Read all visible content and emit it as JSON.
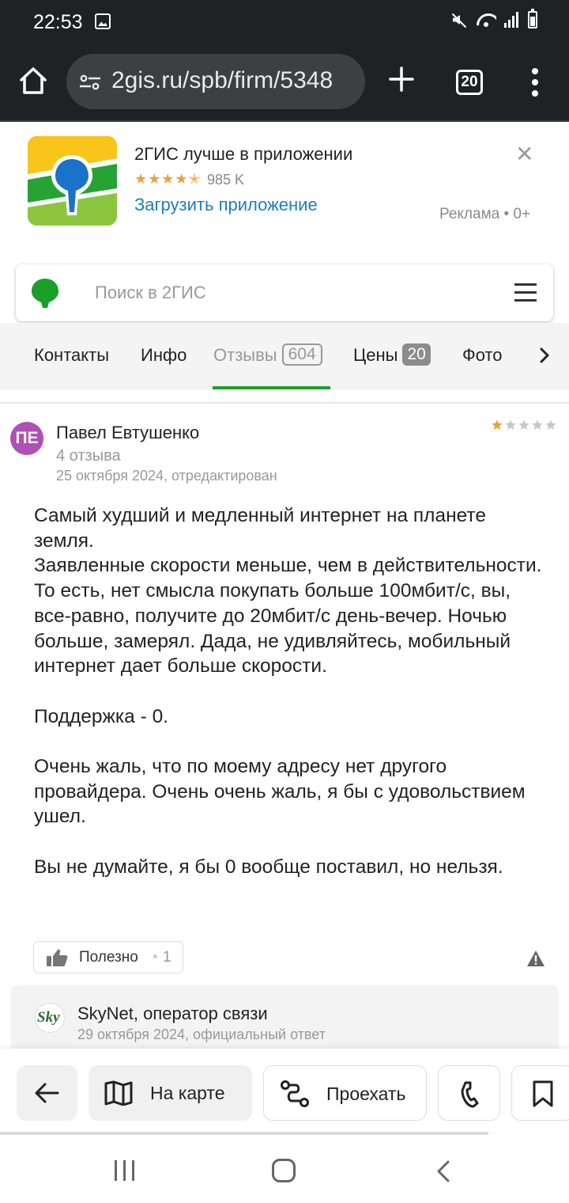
{
  "status_bar": {
    "time": "22:53"
  },
  "browser": {
    "url": "2gis.ru/spb/firm/5348",
    "tabs_count": "20"
  },
  "app_banner": {
    "title": "2ГИС лучше в приложении",
    "rating_stars": "★★★★✭",
    "reviews_count": "985 K",
    "download_link": "Загрузить приложение",
    "ad_label": "Реклама • 0+",
    "close_glyph": "✕"
  },
  "search": {
    "placeholder": "Поиск в 2ГИС"
  },
  "tabs": [
    {
      "label": "Контакты"
    },
    {
      "label": "Инфо"
    },
    {
      "label": "Отзывы",
      "badge": "604"
    },
    {
      "label": "Цены",
      "badge": "20"
    },
    {
      "label": "Фото"
    }
  ],
  "review": {
    "avatar_initials": "ПЕ",
    "author": "Павел Евтушенко",
    "author_reviews": "4 отзыва",
    "date": "25 октября 2024, отредактирован",
    "rating": 1,
    "rating_max": 5,
    "text": "Самый худший и медленный интернет на планете земля.\nЗаявленные скорости меньше, чем в действительности. То есть, нет смысла покупать больше 100мбит/с, вы, все-равно, получите до 20мбит/с день-вечер. Ночью больше, замерял. Дада, не удивляйтесь, мобильный интернет дает больше скорости.\n\nПоддержка - 0.\n\nОчень жаль, что по моему адресу нет другого провайдера. Очень очень жаль, я бы с удовольствием ушел.\n\nВы не думайте, я бы 0 вообще поставил, но нельзя.",
    "helpful_label": "Полезно",
    "helpful_separator": "•",
    "helpful_count": "1"
  },
  "official_response": {
    "logo_text": "Sky",
    "company": "SkyNet, оператор связи",
    "date": "29 октября 2024, официальный ответ"
  },
  "actions": {
    "on_map": "На карте",
    "route": "Проехать"
  },
  "colors": {
    "brand_green": "#1a9f29",
    "star_gold": "#e9a23b",
    "link_blue": "#1b7ec2",
    "avatar_purple": "#b04fb5"
  },
  "icons": [
    "home-icon",
    "tune-icon",
    "plus-icon",
    "tab-switcher-icon",
    "more-vert-icon",
    "gallery-icon",
    "mute-icon",
    "wifi-icon",
    "signal-icon",
    "battery-icon",
    "close-icon",
    "menu-icon",
    "chevron-right-icon",
    "thumb-up-icon",
    "warning-icon",
    "arrow-left-icon",
    "map-icon",
    "route-icon",
    "phone-icon",
    "bookmark-icon"
  ]
}
